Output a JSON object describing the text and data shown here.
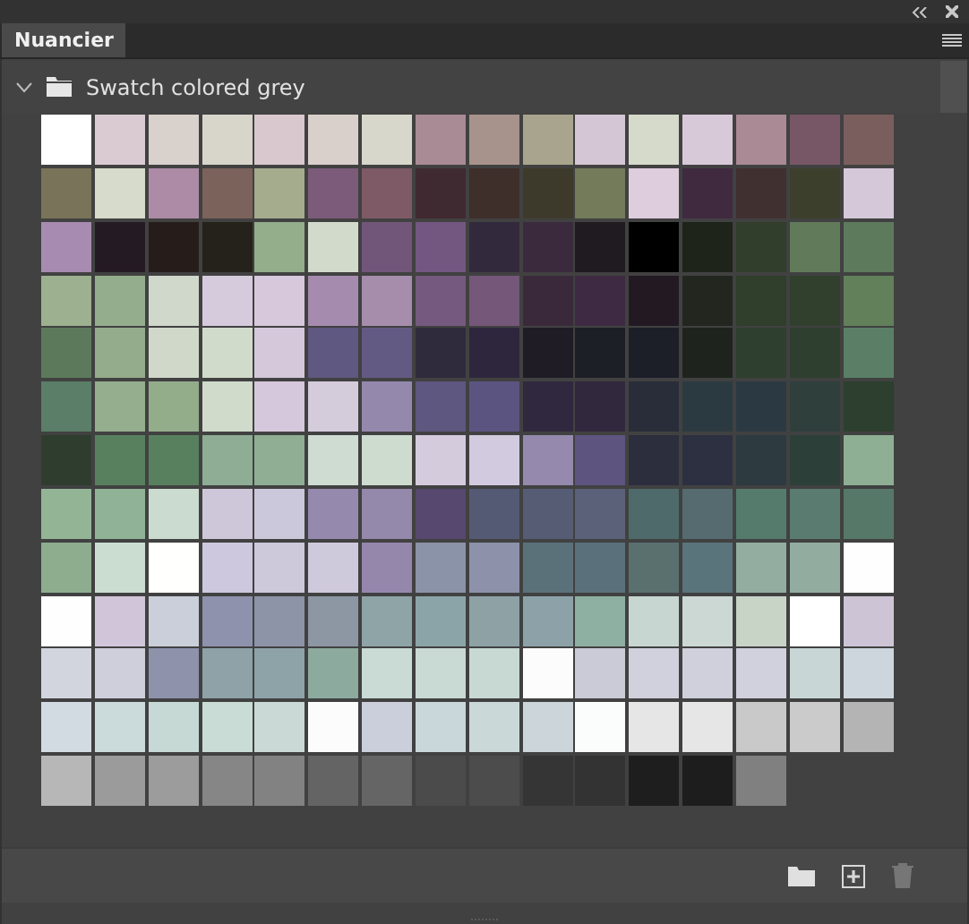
{
  "panel": {
    "tab": {
      "label": "Nuancier",
      "selected": true
    },
    "group": {
      "name": "Swatch colored grey",
      "expanded": true
    }
  },
  "swatches": [
    {
      "color": "#ffffff"
    },
    {
      "color": "#dacbd2"
    },
    {
      "color": "#d9d1cc"
    },
    {
      "color": "#d8d6cb"
    },
    {
      "color": "#d9c8cd"
    },
    {
      "color": "#d9d0cc"
    },
    {
      "color": "#d7d7cb"
    },
    {
      "color": "#a98b95"
    },
    {
      "color": "#a8938c"
    },
    {
      "color": "#a9a48d"
    },
    {
      "color": "#d4c6d4"
    },
    {
      "color": "#d6dacb"
    },
    {
      "color": "#d8c9d8"
    },
    {
      "color": "#a98a95"
    },
    {
      "color": "#775766"
    },
    {
      "color": "#7a5e5e"
    },
    {
      "color": "#797359"
    },
    {
      "color": "#d6dbcb"
    },
    {
      "color": "#ad8ba6"
    },
    {
      "color": "#7b625b"
    },
    {
      "color": "#a5ac8d"
    },
    {
      "color": "#7c5b7a"
    },
    {
      "color": "#7e5a66"
    },
    {
      "color": "#402a31"
    },
    {
      "color": "#3e2f2b"
    },
    {
      "color": "#3e3a2b"
    },
    {
      "color": "#737b5a"
    },
    {
      "color": "#decddd"
    },
    {
      "color": "#402a40"
    },
    {
      "color": "#40302f"
    },
    {
      "color": "#3c3f2b"
    },
    {
      "color": "#d5c8d9"
    },
    {
      "color": "#a88bb0"
    },
    {
      "color": "#241a24"
    },
    {
      "color": "#261d1a"
    },
    {
      "color": "#24221a"
    },
    {
      "color": "#94ad8b"
    },
    {
      "color": "#d2dbcb"
    },
    {
      "color": "#715679"
    },
    {
      "color": "#735780"
    },
    {
      "color": "#33293d"
    },
    {
      "color": "#3b2a3e"
    },
    {
      "color": "#201b20"
    },
    {
      "color": "#000000"
    },
    {
      "color": "#1e241a"
    },
    {
      "color": "#303e2b"
    },
    {
      "color": "#617b5a"
    },
    {
      "color": "#5d7a5c"
    },
    {
      "color": "#9db08f"
    },
    {
      "color": "#94ae8d"
    },
    {
      "color": "#d0d7cb"
    },
    {
      "color": "#d6cbdd"
    },
    {
      "color": "#d8c8dc"
    },
    {
      "color": "#a58bae"
    },
    {
      "color": "#a58dab"
    },
    {
      "color": "#75597e"
    },
    {
      "color": "#745779"
    },
    {
      "color": "#3a293b"
    },
    {
      "color": "#3e2a42"
    },
    {
      "color": "#231923"
    },
    {
      "color": "#23261f"
    },
    {
      "color": "#303e2c"
    },
    {
      "color": "#30402d"
    },
    {
      "color": "#62805a"
    },
    {
      "color": "#5c7a5b"
    },
    {
      "color": "#94ab8c"
    },
    {
      "color": "#d0d9c9"
    },
    {
      "color": "#d1dbcb"
    },
    {
      "color": "#d6c8db"
    },
    {
      "color": "#5f5880"
    },
    {
      "color": "#635a83"
    },
    {
      "color": "#302a3d"
    },
    {
      "color": "#2e263d"
    },
    {
      "color": "#1f1c26"
    },
    {
      "color": "#1c1f25"
    },
    {
      "color": "#1c1f28"
    },
    {
      "color": "#1e241d"
    },
    {
      "color": "#2e3f2f"
    },
    {
      "color": "#2e3f30"
    },
    {
      "color": "#5a7f66"
    },
    {
      "color": "#5a7e68"
    },
    {
      "color": "#94ae8e"
    },
    {
      "color": "#93ad8b"
    },
    {
      "color": "#d0dbcb"
    },
    {
      "color": "#d6c8dc"
    },
    {
      "color": "#d4cbdb"
    },
    {
      "color": "#9489ad"
    },
    {
      "color": "#5e5780"
    },
    {
      "color": "#5c5480"
    },
    {
      "color": "#30283e"
    },
    {
      "color": "#31283e"
    },
    {
      "color": "#292d39"
    },
    {
      "color": "#2b3a40"
    },
    {
      "color": "#2b3a42"
    },
    {
      "color": "#2e3f3c"
    },
    {
      "color": "#2d3f2e"
    },
    {
      "color": "#2f3d2f"
    },
    {
      "color": "#58805f"
    },
    {
      "color": "#58805e"
    },
    {
      "color": "#8ead94"
    },
    {
      "color": "#8fae94"
    },
    {
      "color": "#cedcd2"
    },
    {
      "color": "#cedccf"
    },
    {
      "color": "#d4cbdd"
    },
    {
      "color": "#d2cade"
    },
    {
      "color": "#9589ad"
    },
    {
      "color": "#5d5480"
    },
    {
      "color": "#2c2d3d"
    },
    {
      "color": "#2d3041"
    },
    {
      "color": "#2d3a40"
    },
    {
      "color": "#2c4039"
    },
    {
      "color": "#8eaf94"
    },
    {
      "color": "#94b496"
    },
    {
      "color": "#90b398"
    },
    {
      "color": "#cbdbd0"
    },
    {
      "color": "#cec6d9"
    },
    {
      "color": "#ccc8db"
    },
    {
      "color": "#9689ae"
    },
    {
      "color": "#9488ab"
    },
    {
      "color": "#56486e"
    },
    {
      "color": "#545a73"
    },
    {
      "color": "#555c74"
    },
    {
      "color": "#5a6179"
    },
    {
      "color": "#4f6a6b"
    },
    {
      "color": "#556b70"
    },
    {
      "color": "#557b6c"
    },
    {
      "color": "#5a7c70"
    },
    {
      "color": "#567869"
    },
    {
      "color": "#8ead8f"
    },
    {
      "color": "#cbddd1"
    },
    {
      "color": "#fffffe"
    },
    {
      "color": "#cdc8dd"
    },
    {
      "color": "#cdc9db"
    },
    {
      "color": "#cfc9dc"
    },
    {
      "color": "#9587ac"
    },
    {
      "color": "#8b93a8"
    },
    {
      "color": "#8d92aa"
    },
    {
      "color": "#5a717a"
    },
    {
      "color": "#5a717c"
    },
    {
      "color": "#59706f"
    },
    {
      "color": "#5a747b"
    },
    {
      "color": "#93ada0"
    },
    {
      "color": "#92ada0"
    },
    {
      "color": "#fefefe"
    },
    {
      "color": "#fffeff"
    },
    {
      "color": "#d1c6d9"
    },
    {
      "color": "#cbcfd9"
    },
    {
      "color": "#8e92ac"
    },
    {
      "color": "#8d94a7"
    },
    {
      "color": "#8d96a3"
    },
    {
      "color": "#8ea4a7"
    },
    {
      "color": "#8ba4a7"
    },
    {
      "color": "#8ea2a6"
    },
    {
      "color": "#8ca2a8"
    },
    {
      "color": "#8eb0a3"
    },
    {
      "color": "#c8d6d1"
    },
    {
      "color": "#cbd8d4"
    },
    {
      "color": "#c8d4c6"
    },
    {
      "color": "#fefffe"
    },
    {
      "color": "#cdc5d6"
    },
    {
      "color": "#d2d4de"
    },
    {
      "color": "#cfcfdc"
    },
    {
      "color": "#8e92ab"
    },
    {
      "color": "#8ea2a7"
    },
    {
      "color": "#8ea3a8"
    },
    {
      "color": "#8daa9e"
    },
    {
      "color": "#c9dbd4"
    },
    {
      "color": "#c9d9d3"
    },
    {
      "color": "#c8d9d4"
    },
    {
      "color": "#fcfcfc"
    },
    {
      "color": "#cacbd7"
    },
    {
      "color": "#d1d1dd"
    },
    {
      "color": "#cfd0dc"
    },
    {
      "color": "#d1d1de"
    },
    {
      "color": "#c8d6d6"
    },
    {
      "color": "#cdd6dc"
    },
    {
      "color": "#d2dbe1"
    },
    {
      "color": "#cbdada"
    },
    {
      "color": "#c6d9d5"
    },
    {
      "color": "#c9dcd5"
    },
    {
      "color": "#cad9d5"
    },
    {
      "color": "#fcfcfd"
    },
    {
      "color": "#cbcedb"
    },
    {
      "color": "#c9d6da"
    },
    {
      "color": "#cad8d8"
    },
    {
      "color": "#cbd5da"
    },
    {
      "color": "#fbfcfc"
    },
    {
      "color": "#e6e6e6"
    },
    {
      "color": "#e6e6e7"
    },
    {
      "color": "#c9c9c9"
    },
    {
      "color": "#cbcbcb"
    },
    {
      "color": "#b4b4b4"
    },
    {
      "color": "#b7b7b7"
    },
    {
      "color": "#9b9b9b"
    },
    {
      "color": "#9c9c9c"
    },
    {
      "color": "#868686"
    },
    {
      "color": "#828282"
    },
    {
      "color": "#646464"
    },
    {
      "color": "#656565"
    },
    {
      "color": "#4b4b4b"
    },
    {
      "color": "#4c4c4c"
    },
    {
      "color": "#353535"
    },
    {
      "color": "#333333"
    },
    {
      "color": "#1e1e1e"
    },
    {
      "color": "#1d1d1d"
    },
    {
      "color": "#808080"
    }
  ]
}
